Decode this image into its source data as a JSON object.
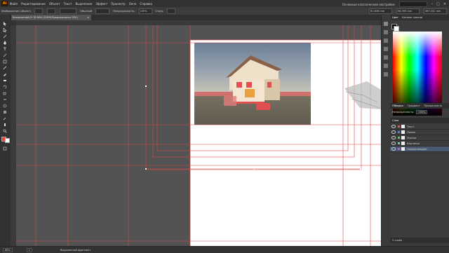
{
  "app": {
    "logo": "Ai"
  },
  "menu": [
    "Файл",
    "Редактирование",
    "Объект",
    "Текст",
    "Выделение",
    "Эффект",
    "Просмотр",
    "Окно",
    "Справка"
  ],
  "workspace": {
    "label": "Основные классические настройки"
  },
  "control": {
    "object_label": "Изображение (объект)",
    "opacity_label": "Непрозрачность:",
    "opacity_value": "100%",
    "style_label": "Стиль",
    "mode_label": "Обычный",
    "x_value": "81,836 mm",
    "y_value": "98,395 mm",
    "w_value": "567,252 mm"
  },
  "document": {
    "tab_label": "Безымянный-1* @ 66% (CMYK/Предпросмотр GPU)",
    "close": "×"
  },
  "status": {
    "zoom": "66%",
    "page": "1",
    "tool_label": "Выделенный фрагмент"
  },
  "panels": {
    "color_tabs": [
      "Цвет",
      "Каталог цветов"
    ],
    "sub_tabs": [
      "Обводка",
      "Градиент",
      "Прозрачность"
    ],
    "opacity_label": "Непрозрачность:",
    "opacity_value": "100%",
    "layers_title": "Слои",
    "layers": [
      {
        "name": "Текст",
        "color": "#ff4f4f"
      },
      {
        "name": "Линии",
        "color": "#4f7fff"
      },
      {
        "name": "Значки",
        "color": "#4fd24f"
      },
      {
        "name": "Картинки",
        "color": "#4fd2d2"
      },
      {
        "name": "Направляющие",
        "color": "#d24fd2"
      }
    ],
    "layers_count": "5 слоёв"
  },
  "colors": {
    "guide": "#e04848",
    "accent": "#ff9a00",
    "selection": "#4a5a72"
  }
}
